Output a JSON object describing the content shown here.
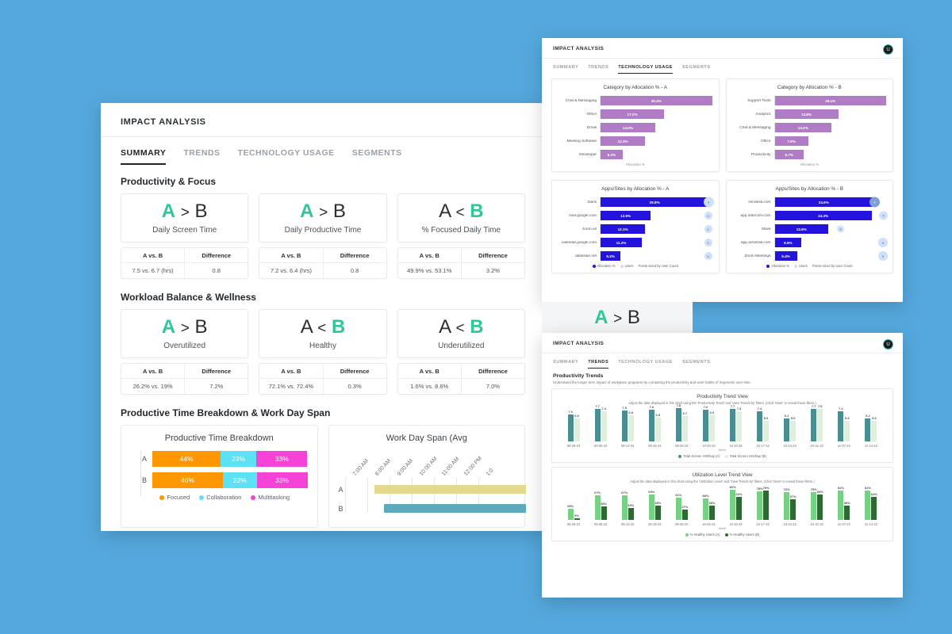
{
  "colors": {
    "background": "#55a8dd",
    "accent_green": "#2fc69a",
    "focused": "#ff9800",
    "collaboration": "#5ce1f5",
    "multitasking": "#f542d7",
    "gantt_a": "#e3da8e",
    "gantt_b": "#5fa9bd",
    "purple": "#b07cc6",
    "blue": "#2413dd",
    "bubble": "#cfe0fb",
    "teal": "#4b8e92",
    "pale_green": "#dfeedd",
    "light_green": "#77d083",
    "dark_green": "#2e6b34"
  },
  "summary_panel": {
    "app_title": "IMPACT ANALYSIS",
    "tabs": [
      {
        "label": "SUMMARY",
        "active": true
      },
      {
        "label": "TRENDS",
        "active": false
      },
      {
        "label": "TECHNOLOGY USAGE",
        "active": false
      },
      {
        "label": "SEGMENTS",
        "active": false
      }
    ],
    "section1": {
      "title": "Productivity & Focus",
      "cards": [
        {
          "left": "A",
          "op": ">",
          "right": "B",
          "highlight": "left",
          "label": "Daily Screen Time",
          "th1": "A vs. B",
          "th2": "Difference",
          "v1": "7.5 vs. 6.7 (hrs)",
          "v2": "0.8"
        },
        {
          "left": "A",
          "op": ">",
          "right": "B",
          "highlight": "left",
          "label": "Daily Productive Time",
          "th1": "A vs. B",
          "th2": "Difference",
          "v1": "7.2 vs. 6.4 (hrs)",
          "v2": "0.8"
        },
        {
          "left": "A",
          "op": "<",
          "right": "B",
          "highlight": "right",
          "label": "% Focused Daily Time",
          "th1": "A vs. B",
          "th2": "Difference",
          "v1": "49.9% vs. 53.1%",
          "v2": "3.2%"
        }
      ]
    },
    "section2": {
      "title": "Workload Balance & Wellness",
      "cards": [
        {
          "left": "A",
          "op": ">",
          "right": "B",
          "highlight": "left",
          "label": "Overutilized",
          "th1": "A vs. B",
          "th2": "Difference",
          "v1": "26.2% vs. 19%",
          "v2": "7.2%"
        },
        {
          "left": "A",
          "op": "<",
          "right": "B",
          "highlight": "right",
          "label": "Healthy",
          "th1": "A vs. B",
          "th2": "Difference",
          "v1": "72.1% vs. 72.4%",
          "v2": "0.3%"
        },
        {
          "left": "A",
          "op": "<",
          "right": "B",
          "highlight": "right",
          "label": "Underutilized",
          "th1": "A vs. B",
          "th2": "Difference",
          "v1": "1.6% vs. 8.6%",
          "v2": "7.0%"
        }
      ]
    },
    "section3": {
      "title": "Productive Time Breakdown & Work Day Span"
    }
  },
  "tech_panel": {
    "app_title": "IMPACT ANALYSIS",
    "avatar": "U",
    "tabs": [
      {
        "label": "SUMMARY",
        "active": false
      },
      {
        "label": "TRENDS",
        "active": false
      },
      {
        "label": "TECHNOLOGY USAGE",
        "active": true
      },
      {
        "label": "SEGMENTS",
        "active": false
      }
    ],
    "overlap_card": {
      "left": "A",
      "op": ">",
      "right": "B"
    }
  },
  "trends_panel": {
    "app_title": "IMPACT ANALYSIS",
    "avatar": "U",
    "tabs": [
      {
        "label": "SUMMARY",
        "active": false
      },
      {
        "label": "TRENDS",
        "active": true
      },
      {
        "label": "TECHNOLOGY USAGE",
        "active": false
      },
      {
        "label": "SEGMENTS",
        "active": false
      }
    ],
    "heading": "Productivity Trends",
    "subheading": "Understand the longer term impact of workplace programs by comparing the productivity and work habits of Segments over time."
  },
  "chart_data": [
    {
      "id": "productive-time-breakdown",
      "type": "bar",
      "orientation": "horizontal-stacked",
      "title": "Productive Time Breakdown",
      "categories": [
        "A",
        "B"
      ],
      "series": [
        {
          "name": "Focused",
          "color": "#ff9800",
          "values": [
            44,
            46
          ],
          "labels": [
            "44%",
            "46%"
          ]
        },
        {
          "name": "Collaboration",
          "color": "#5ce1f5",
          "values": [
            23,
            22
          ],
          "labels": [
            "23%",
            "22%"
          ]
        },
        {
          "name": "Multitasking",
          "color": "#f542d7",
          "values": [
            33,
            33
          ],
          "labels": [
            "33%",
            "33%"
          ]
        }
      ],
      "legend": [
        "Focused",
        "Collaboration",
        "Multitasking"
      ],
      "legend_position": "bottom"
    },
    {
      "id": "work-day-span",
      "type": "bar",
      "orientation": "gantt",
      "title": "Work Day Span (Avg",
      "categories": [
        "A",
        "B"
      ],
      "ticks": [
        "7:00 AM",
        "8:00 AM",
        "9:00 AM",
        "10:00 AM",
        "11:00 AM",
        "12:00 PM",
        "1:0"
      ],
      "bars": [
        {
          "name": "A",
          "color": "#e3da8e",
          "start": "8:20 AM",
          "end": "beyond"
        },
        {
          "name": "B",
          "color": "#5fa9bd",
          "start": "8:40 AM",
          "end": "beyond"
        }
      ]
    },
    {
      "id": "category-allocation-a",
      "type": "bar",
      "orientation": "horizontal",
      "title": "Category by Allocation % - A",
      "xlabel": "Allocation %",
      "categories": [
        "Chat & Messaging",
        "Office",
        "Email",
        "Meeting Software",
        "Developer"
      ],
      "values": [
        30.4,
        17.2,
        14.9,
        12.3,
        6.2
      ],
      "labels": [
        "30.4%",
        "17.2%",
        "14.9%",
        "12.3%",
        "6.2%"
      ],
      "color": "#b07cc6"
    },
    {
      "id": "category-allocation-b",
      "type": "bar",
      "orientation": "horizontal",
      "title": "Category by Allocation % - B",
      "xlabel": "Allocation %",
      "categories": [
        "Support Tools",
        "Analytics",
        "Chat & Messaging",
        "Office",
        "Productivity"
      ],
      "values": [
        26.1,
        14.8,
        13.2,
        7.9,
        6.7
      ],
      "labels": [
        "26.1%",
        "14.8%",
        "13.2%",
        "7.9%",
        "6.7%"
      ],
      "color": "#b07cc6"
    },
    {
      "id": "apps-allocation-a",
      "type": "bar",
      "orientation": "horizontal",
      "title": "Apps/Sites by Allocation % - A",
      "categories": [
        "Slack",
        "mail.google.com",
        "zoom.us",
        "calendar.google.com",
        "atlassian.net"
      ],
      "values": [
        29.8,
        13.9,
        12.1,
        11.2,
        5.2
      ],
      "labels": [
        "29.8%",
        "13.9%",
        "12.1%",
        "11.2%",
        "5.2%"
      ],
      "users": [
        3,
        3,
        3,
        3,
        3
      ],
      "bubble_sizes": [
        13,
        10,
        10,
        10,
        10
      ],
      "color": "#2413dd",
      "legend": [
        "Allocation %",
        "Users",
        "Points sized by User Count"
      ]
    },
    {
      "id": "apps-allocation-b",
      "type": "bar",
      "orientation": "horizontal",
      "title": "Apps/Sites by Allocation % - B",
      "categories": [
        "zendesk.com",
        "app.intercom.com",
        "Slack",
        "app.activtrak.com",
        "Zoom Meetings"
      ],
      "values": [
        24.6,
        24.3,
        13.6,
        6.6,
        5.4
      ],
      "labels": [
        "24.6%",
        "24.3%",
        "13.6%",
        "6.6%",
        "5.4%"
      ],
      "users": [
        9,
        9,
        8,
        9,
        9
      ],
      "bubble_sizes": [
        13,
        11,
        9,
        12,
        12
      ],
      "color": "#2413dd",
      "legend": [
        "Allocation %",
        "Users",
        "Points sized by User Count"
      ]
    },
    {
      "id": "productivity-trend-view",
      "type": "bar",
      "orientation": "grouped-vertical",
      "title": "Productivity Trend View",
      "note": "Adjust the data displayed in this chart using the 'Productivity Trend' and 'View Trends by' filters. (Click 'More' to reveal these filters.)",
      "xlabel": "Week",
      "categories": [
        "08-29-22",
        "09-05-22",
        "09-12-22",
        "09-19-22",
        "09-26-22",
        "10-03-22",
        "10-10-22",
        "10-17-22",
        "10-24-22",
        "10-31-22",
        "11-07-22",
        "11-14-22"
      ],
      "series": [
        {
          "name": "Total Screen Hrs/Day (A)",
          "color": "#4b8e92",
          "values": [
            7.0,
            7.7,
            7.5,
            7.6,
            7.8,
            7.6,
            7.7,
            7.4,
            6.2,
            7.7,
            7.4,
            6.2
          ],
          "labels": [
            "7.0",
            "7.7",
            "7.5",
            "7.6",
            "7.8",
            "7.6",
            "7.7",
            "7.4",
            "6.2",
            "7.7",
            "7.4",
            "6.2"
          ]
        },
        {
          "name": "Total Screen Hrs/Day (B)",
          "color": "#dfeedd",
          "values": [
            6.6,
            7.4,
            6.8,
            6.5,
            6.7,
            6.9,
            7.4,
            5.6,
            5.6,
            7.8,
            5.6,
            5.6
          ],
          "labels": [
            "6.6",
            "7.4",
            "6.8",
            "6.5",
            "6.7",
            "6.9",
            "7.4",
            "5.6",
            "5.6",
            "7.8",
            "5.6",
            "5.6"
          ]
        }
      ],
      "legend_position": "bottom"
    },
    {
      "id": "utilization-level-trend-view",
      "type": "bar",
      "orientation": "grouped-vertical",
      "title": "Utilization Level Trend View",
      "note": "Adjust the data displayed in this chart using the 'Utilization Level' and 'View Trends by' filters. (Click 'More' to reveal these filters.)",
      "xlabel": "Week",
      "categories": [
        "08-29-22",
        "09-05-22",
        "09-12-22",
        "09-19-22",
        "09-26-22",
        "10-03-22",
        "10-10-22",
        "10-17-22",
        "10-24-22",
        "10-31-22",
        "11-07-22",
        "11-14-22"
      ],
      "series": [
        {
          "name": "% Healthy Users (A)",
          "color": "#77d083",
          "values": [
            29,
            67,
            67,
            69,
            61,
            58,
            82,
            78,
            76,
            75,
            81,
            81
          ],
          "labels": [
            "29%",
            "67%",
            "67%",
            "69%",
            "61%",
            "58%",
            "82%",
            "78%",
            "76%",
            "75%",
            "81%",
            "81%"
          ]
        },
        {
          "name": "% Healthy Users (B)",
          "color": "#2e6b34",
          "values": [
            5,
            36,
            33,
            38,
            27,
            38,
            63,
            79,
            57,
            69,
            38,
            64
          ],
          "labels": [
            "5%",
            "36%",
            "33%",
            "38%",
            "27%",
            "38%",
            "63%",
            "79%",
            "57%",
            "69%",
            "38%",
            "64%"
          ]
        }
      ],
      "legend_position": "bottom"
    }
  ]
}
